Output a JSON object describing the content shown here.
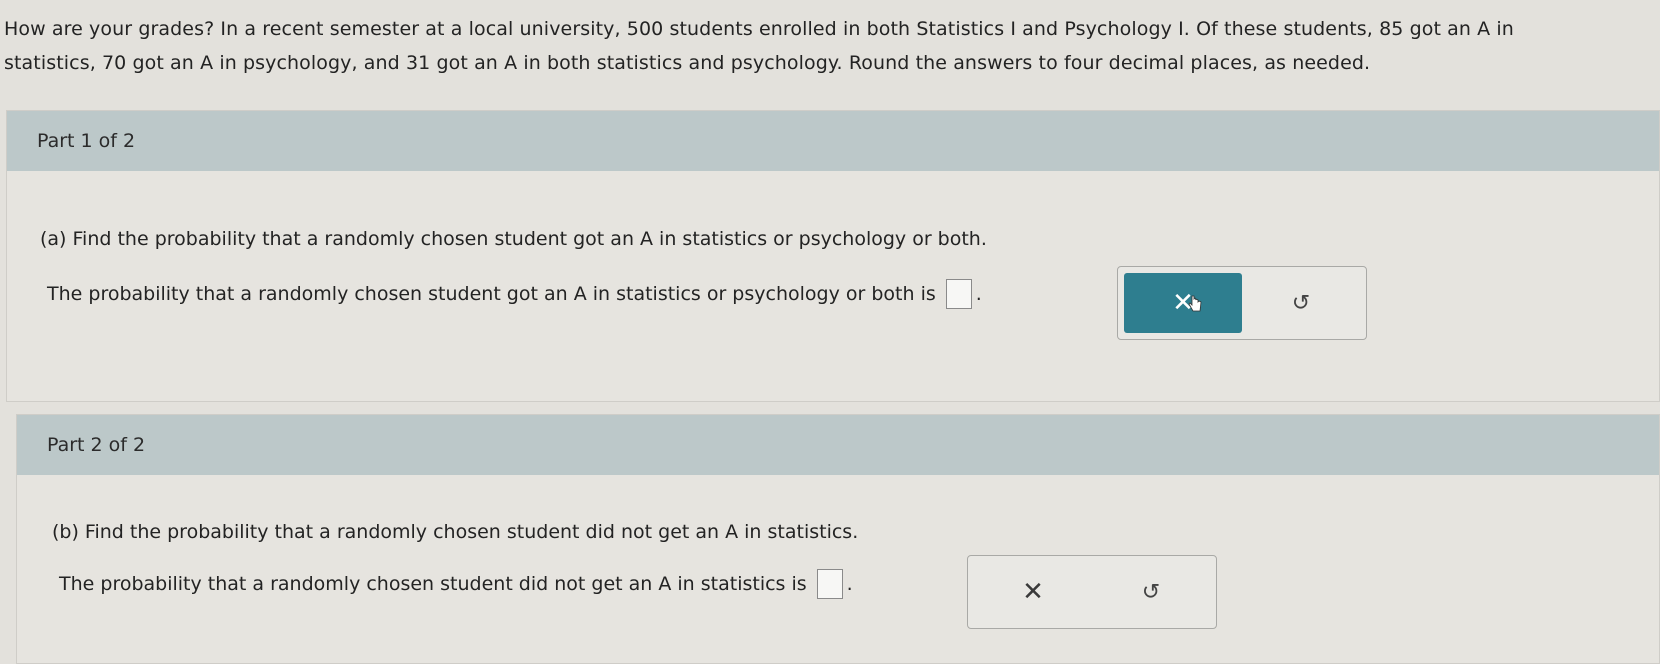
{
  "problem": {
    "line1": "How are your grades? In a recent semester at a local university, 500 students enrolled in both Statistics I and Psychology I. Of these students, 85 got an A in",
    "line2": "statistics, 70 got an A in psychology, and 31 got an A in both statistics and psychology. Round the answers to four decimal places, as needed."
  },
  "part1": {
    "header": "Part 1 of 2",
    "question": "(a) Find the probability that a randomly chosen student got an A in statistics or psychology or both.",
    "answer_prefix": "The probability that a randomly chosen student got an A in statistics or psychology or both is",
    "answer_suffix": ".",
    "answer_value": "",
    "clear_icon": "✕",
    "redo_icon": "↺"
  },
  "part2": {
    "header": "Part 2 of 2",
    "question": "(b) Find the probability that a randomly chosen student did not get an A in statistics.",
    "answer_prefix": "The probability that a randomly chosen student did not get an A in statistics is",
    "answer_suffix": ".",
    "answer_value": "",
    "clear_icon": "✕",
    "redo_icon": "↺"
  },
  "colors": {
    "header_bg": "#bcc8c9",
    "active_button": "#2e7e8f"
  }
}
